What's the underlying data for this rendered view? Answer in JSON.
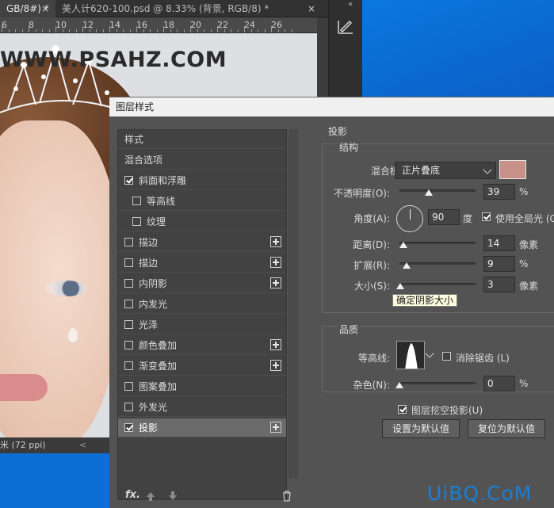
{
  "tabs": [
    {
      "label": "GB/8#) *",
      "close": "×"
    },
    {
      "label": "美人计620-100.psd @ 8.33% (背景, RGB/8) *",
      "close": "×"
    }
  ],
  "ruler": {
    "numbers": [
      "6",
      "8",
      "10",
      "12",
      "14",
      "16",
      "18",
      "20",
      "22",
      "24",
      "26"
    ]
  },
  "canvas": {
    "watermark": "WWW.PSAHZ.COM"
  },
  "status_bar": {
    "text": "米 (72 ppi)",
    "arrow": "<"
  },
  "toolbar_right": {
    "collapse": "«",
    "tool_icon": "ruler-pen-icon"
  },
  "dialog": {
    "title": "图层样式",
    "styles": [
      {
        "label": "样式",
        "checkbox": null,
        "plus": false,
        "indent": 0,
        "selected": false
      },
      {
        "label": "混合选项",
        "checkbox": null,
        "plus": false,
        "indent": 0,
        "selected": false
      },
      {
        "label": "斜面和浮雕",
        "checkbox": true,
        "plus": false,
        "indent": 0,
        "selected": false
      },
      {
        "label": "等高线",
        "checkbox": false,
        "plus": false,
        "indent": 1,
        "selected": false
      },
      {
        "label": "纹理",
        "checkbox": false,
        "plus": false,
        "indent": 1,
        "selected": false
      },
      {
        "label": "描边",
        "checkbox": false,
        "plus": true,
        "indent": 0,
        "selected": false
      },
      {
        "label": "描边",
        "checkbox": false,
        "plus": true,
        "indent": 0,
        "selected": false
      },
      {
        "label": "内阴影",
        "checkbox": false,
        "plus": true,
        "indent": 0,
        "selected": false
      },
      {
        "label": "内发光",
        "checkbox": false,
        "plus": false,
        "indent": 0,
        "selected": false
      },
      {
        "label": "光泽",
        "checkbox": false,
        "plus": false,
        "indent": 0,
        "selected": false
      },
      {
        "label": "颜色叠加",
        "checkbox": false,
        "plus": true,
        "indent": 0,
        "selected": false
      },
      {
        "label": "渐变叠加",
        "checkbox": false,
        "plus": true,
        "indent": 0,
        "selected": false
      },
      {
        "label": "图案叠加",
        "checkbox": false,
        "plus": false,
        "indent": 0,
        "selected": false
      },
      {
        "label": "外发光",
        "checkbox": false,
        "plus": false,
        "indent": 0,
        "selected": false
      },
      {
        "label": "投影",
        "checkbox": true,
        "plus": true,
        "indent": 0,
        "selected": true
      }
    ],
    "list_footer": {
      "fx": "fx.",
      "up_icon": "arrow-up-icon",
      "down_icon": "arrow-down-icon",
      "trash_icon": "trash-icon"
    },
    "drop_shadow": {
      "title": "投影",
      "structure_title": "结构",
      "blend_mode_label": "混合模式:",
      "blend_mode_value": "正片叠底",
      "shadow_color": "#c79088",
      "opacity_label": "不透明度(O):",
      "opacity_value": "39",
      "opacity_unit": "%",
      "angle_label": "角度(A):",
      "angle_value": "90",
      "angle_unit": "度",
      "global_light_label": "使用全局光 (G",
      "global_light_checked": true,
      "distance_label": "距离(D):",
      "distance_value": "14",
      "distance_unit": "像素",
      "spread_label": "扩展(R):",
      "spread_value": "9",
      "spread_unit": "%",
      "size_label": "大小(S):",
      "size_value": "3",
      "size_unit": "像素",
      "tooltip": "确定阴影大小",
      "quality_title": "品质",
      "contour_label": "等高线:",
      "antialias_label": "消除锯齿 (L)",
      "antialias_checked": false,
      "noise_label": "杂色(N):",
      "noise_value": "0",
      "noise_unit": "%",
      "knockout_label": "图层挖空投影(U)",
      "knockout_checked": true,
      "set_default_label": "设置为默认值",
      "reset_default_label": "复位为默认值"
    }
  },
  "site_logo": "UiBQ.CoM"
}
